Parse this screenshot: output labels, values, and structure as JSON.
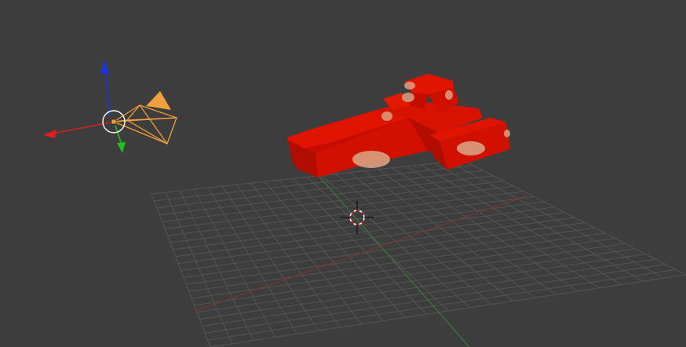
{
  "app": {
    "name": "3D viewport"
  },
  "viewport": {
    "background_color": "#3d3d3d",
    "grid_color": "#5a5a5a",
    "axis_x_color": "#8a3a3a",
    "axis_y_color": "#3e7a3e"
  },
  "scene": {
    "objects": [
      {
        "kind": "camera",
        "selected": true,
        "outline_color": "#f0a03c"
      },
      {
        "kind": "mesh",
        "description_icon": "car-mesh",
        "base_color": "#d80f00",
        "spot_color": "#d9a080"
      },
      {
        "kind": "3d-cursor",
        "icon": "crosshair-icon"
      }
    ]
  },
  "gizmo": {
    "x_color": "#e02020",
    "y_color": "#1fc01f",
    "z_color": "#2030e0",
    "icon": "transform-gizmo-icon"
  }
}
